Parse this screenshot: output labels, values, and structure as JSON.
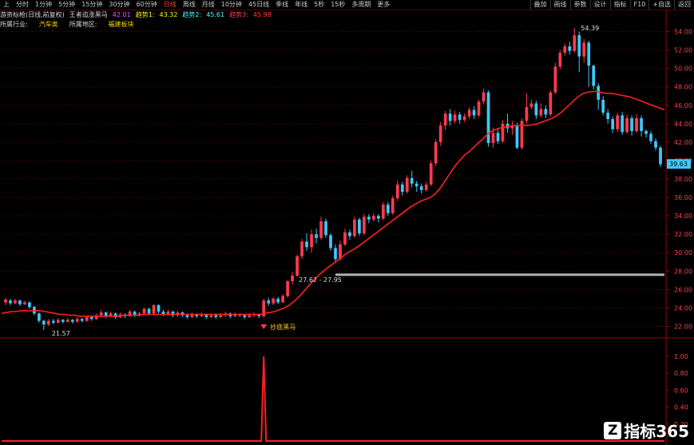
{
  "toolbar": {
    "tabs": [
      "上",
      "分时",
      "1分钟",
      "5分钟",
      "15分钟",
      "30分钟",
      "60分钟",
      "日线",
      "周线",
      "月线",
      "10分钟",
      "45日线",
      "季线",
      "年线",
      "5秒",
      "15秒",
      "多周期",
      "更多"
    ],
    "active_tab": "日线",
    "right_tabs": [
      "叠加",
      "画线",
      "参数",
      "设计",
      "指标",
      "F10",
      "+自选",
      "返回"
    ]
  },
  "indicator_row": {
    "name": "游资标枪(日线,前复权)",
    "formula": "王者追涨黑马",
    "v0_label": "42.01",
    "line1_label": "趋势1:",
    "line1_value": "43.32",
    "line2_label": "趋势2:",
    "line2_value": "45.61",
    "line3_label": "趋势3:",
    "line3_value": "45.98"
  },
  "info_row": {
    "industry_label": "所属行业:",
    "industry_value": "汽车类",
    "region_label": "所属地区:",
    "region_value": "福建板块"
  },
  "chart_data": {
    "type": "candlestick",
    "y_ticks": [
      "54.00",
      "52.00",
      "50.00",
      "48.00",
      "46.00",
      "44.00",
      "42.00",
      "40.00",
      "38.00",
      "36.00",
      "34.00",
      "32.00",
      "30.00",
      "28.00",
      "26.00",
      "24.00",
      "22.00"
    ],
    "ylim": [
      21,
      55
    ],
    "high_label": "54.39",
    "low_label": "21.57",
    "gap_label": "27.62 - 27.95",
    "current_price": "39.63",
    "signal_label": "抄底黑马",
    "support_level": 27.6,
    "colors": {
      "up": "#ff3b4e",
      "down": "#3ec8ff",
      "ma": "#ff2020",
      "signal": "#ff2020",
      "grid": "#5a0000",
      "support": "#b4b4b4"
    },
    "candles": [
      [
        24.6,
        24.9,
        24.3,
        25.1
      ],
      [
        24.8,
        24.5,
        24.3,
        25.0
      ],
      [
        24.5,
        24.8,
        24.4,
        25.0
      ],
      [
        24.8,
        24.4,
        24.2,
        24.9
      ],
      [
        24.4,
        24.6,
        24.3,
        24.8
      ],
      [
        24.6,
        24.1,
        23.9,
        24.7
      ],
      [
        24.1,
        23.4,
        23.2,
        24.2
      ],
      [
        23.4,
        22.6,
        22.4,
        23.5
      ],
      [
        22.6,
        22.2,
        21.6,
        22.7
      ],
      [
        22.2,
        22.6,
        22.0,
        22.8
      ],
      [
        22.6,
        22.4,
        22.2,
        22.8
      ],
      [
        22.4,
        22.7,
        22.3,
        22.9
      ],
      [
        22.7,
        22.5,
        22.3,
        22.8
      ],
      [
        22.5,
        22.7,
        22.4,
        22.9
      ],
      [
        22.7,
        22.5,
        22.3,
        22.8
      ],
      [
        22.5,
        22.8,
        22.4,
        23.0
      ],
      [
        22.8,
        22.6,
        22.4,
        22.9
      ],
      [
        22.6,
        23.0,
        22.5,
        23.1
      ],
      [
        23.0,
        22.8,
        22.6,
        23.1
      ],
      [
        22.8,
        23.2,
        22.7,
        23.4
      ],
      [
        23.2,
        23.5,
        23.0,
        23.8
      ],
      [
        23.5,
        23.1,
        22.9,
        23.6
      ],
      [
        23.1,
        23.4,
        23.0,
        23.6
      ],
      [
        23.4,
        23.0,
        22.8,
        23.5
      ],
      [
        23.0,
        23.3,
        22.9,
        23.5
      ],
      [
        23.3,
        23.1,
        22.9,
        23.4
      ],
      [
        23.1,
        23.6,
        23.0,
        23.8
      ],
      [
        23.6,
        23.2,
        23.0,
        23.7
      ],
      [
        23.2,
        23.4,
        23.0,
        23.6
      ],
      [
        23.4,
        23.9,
        23.3,
        24.0
      ],
      [
        23.9,
        23.4,
        23.2,
        24.0
      ],
      [
        23.4,
        24.3,
        23.3,
        24.4
      ],
      [
        24.3,
        23.6,
        23.4,
        24.4
      ],
      [
        23.6,
        23.3,
        23.1,
        23.8
      ],
      [
        23.3,
        23.6,
        23.2,
        23.8
      ],
      [
        23.6,
        23.2,
        23.0,
        23.7
      ],
      [
        23.2,
        23.5,
        23.0,
        23.7
      ],
      [
        23.5,
        23.2,
        23.0,
        23.6
      ],
      [
        23.2,
        23.0,
        22.8,
        23.4
      ],
      [
        23.0,
        23.3,
        22.9,
        23.5
      ],
      [
        23.3,
        23.1,
        22.9,
        23.4
      ],
      [
        23.1,
        23.3,
        23.0,
        23.5
      ],
      [
        23.3,
        23.0,
        22.8,
        23.4
      ],
      [
        23.0,
        23.2,
        22.9,
        23.4
      ],
      [
        23.2,
        23.0,
        22.8,
        23.4
      ],
      [
        23.0,
        23.2,
        22.9,
        23.4
      ],
      [
        23.2,
        23.4,
        23.0,
        23.6
      ],
      [
        23.4,
        23.1,
        22.9,
        23.5
      ],
      [
        23.1,
        23.3,
        23.0,
        23.5
      ],
      [
        23.3,
        23.2,
        23.0,
        23.4
      ],
      [
        23.2,
        23.0,
        22.8,
        23.3
      ],
      [
        23.0,
        23.2,
        22.9,
        23.4
      ],
      [
        23.2,
        23.3,
        23.0,
        23.5
      ],
      [
        23.3,
        23.1,
        22.9,
        23.4
      ],
      [
        23.1,
        24.8,
        23.0,
        25.0
      ],
      [
        24.8,
        24.5,
        24.2,
        25.1
      ],
      [
        24.5,
        25.0,
        24.3,
        25.2
      ],
      [
        25.0,
        24.6,
        24.4,
        25.2
      ],
      [
        24.6,
        25.3,
        24.5,
        25.5
      ],
      [
        25.3,
        26.9,
        25.1,
        27.0
      ],
      [
        26.9,
        27.5,
        26.5,
        27.9
      ],
      [
        27.5,
        29.6,
        27.4,
        29.8
      ],
      [
        29.6,
        31.2,
        29.3,
        31.5
      ],
      [
        31.2,
        30.6,
        30.2,
        32.1
      ],
      [
        30.6,
        32.0,
        30.0,
        32.5
      ],
      [
        32.0,
        31.6,
        31.0,
        32.6
      ],
      [
        31.6,
        33.4,
        31.4,
        33.9
      ],
      [
        33.4,
        31.9,
        31.6,
        33.7
      ],
      [
        31.9,
        30.5,
        30.2,
        32.1
      ],
      [
        30.5,
        29.3,
        28.9,
        30.9
      ],
      [
        29.3,
        30.9,
        29.1,
        31.3
      ],
      [
        30.9,
        32.2,
        30.7,
        32.6
      ],
      [
        32.2,
        31.8,
        31.4,
        32.5
      ],
      [
        31.8,
        33.6,
        31.6,
        33.9
      ],
      [
        33.6,
        32.1,
        31.8,
        33.8
      ],
      [
        32.1,
        33.9,
        31.9,
        34.2
      ],
      [
        33.9,
        33.6,
        33.2,
        34.2
      ],
      [
        33.6,
        34.0,
        33.4,
        34.3
      ],
      [
        34.0,
        33.7,
        33.3,
        34.2
      ],
      [
        33.7,
        35.2,
        33.5,
        35.5
      ],
      [
        35.2,
        34.3,
        34.0,
        35.5
      ],
      [
        34.3,
        35.9,
        34.1,
        36.2
      ],
      [
        35.9,
        37.4,
        35.6,
        37.8
      ],
      [
        37.4,
        36.6,
        36.2,
        37.7
      ],
      [
        36.6,
        38.1,
        36.4,
        38.4
      ],
      [
        38.1,
        37.5,
        37.1,
        38.9
      ],
      [
        37.5,
        37.2,
        36.6,
        37.8
      ],
      [
        37.2,
        36.8,
        36.4,
        37.5
      ],
      [
        36.8,
        37.4,
        36.6,
        37.7
      ],
      [
        37.4,
        39.7,
        37.2,
        40.0
      ],
      [
        39.7,
        42.0,
        39.4,
        42.3
      ],
      [
        42.0,
        43.8,
        41.6,
        44.2
      ],
      [
        43.8,
        45.1,
        43.3,
        45.4
      ],
      [
        45.1,
        44.3,
        43.8,
        45.6
      ],
      [
        44.3,
        45.0,
        44.0,
        45.4
      ],
      [
        45.0,
        44.4,
        44.0,
        45.3
      ],
      [
        44.4,
        44.8,
        44.2,
        45.1
      ],
      [
        44.8,
        45.5,
        44.5,
        45.8
      ],
      [
        45.5,
        44.9,
        44.5,
        45.9
      ],
      [
        44.9,
        46.4,
        44.7,
        46.6
      ],
      [
        46.4,
        47.4,
        46.1,
        47.8
      ],
      [
        47.4,
        41.9,
        41.5,
        47.6
      ],
      [
        41.9,
        43.0,
        41.4,
        43.6
      ],
      [
        43.0,
        42.1,
        41.8,
        43.4
      ],
      [
        42.1,
        44.0,
        41.9,
        44.4
      ],
      [
        44.0,
        43.5,
        43.0,
        45.1
      ],
      [
        43.5,
        43.8,
        42.8,
        44.3
      ],
      [
        43.8,
        41.4,
        41.2,
        44.1
      ],
      [
        41.4,
        44.3,
        41.2,
        44.6
      ],
      [
        44.3,
        45.8,
        44.0,
        47.3
      ],
      [
        45.8,
        46.2,
        45.6,
        46.6
      ],
      [
        46.2,
        44.9,
        44.5,
        46.5
      ],
      [
        44.9,
        45.6,
        44.7,
        46.2
      ],
      [
        45.6,
        45.0,
        44.6,
        46.0
      ],
      [
        45.0,
        47.4,
        44.8,
        47.6
      ],
      [
        47.4,
        50.2,
        47.2,
        50.6
      ],
      [
        50.2,
        51.7,
        49.9,
        52.0
      ],
      [
        51.7,
        52.4,
        51.4,
        52.7
      ],
      [
        52.4,
        51.9,
        51.5,
        52.9
      ],
      [
        51.9,
        53.6,
        51.7,
        54.4
      ],
      [
        53.6,
        51.3,
        49.6,
        54.0
      ],
      [
        51.3,
        52.8,
        50.6,
        53.2
      ],
      [
        52.8,
        50.3,
        48.0,
        53.0
      ],
      [
        50.3,
        48.1,
        47.7,
        50.4
      ],
      [
        48.1,
        46.6,
        45.5,
        48.4
      ],
      [
        46.6,
        45.2,
        44.9,
        47.0
      ],
      [
        45.2,
        44.5,
        44.0,
        45.6
      ],
      [
        44.5,
        43.4,
        43.0,
        44.8
      ],
      [
        43.4,
        44.9,
        43.1,
        45.2
      ],
      [
        44.9,
        43.1,
        42.8,
        45.3
      ],
      [
        43.1,
        44.6,
        42.9,
        45.0
      ],
      [
        44.6,
        43.2,
        42.7,
        44.9
      ],
      [
        43.2,
        44.6,
        43.0,
        45.0
      ],
      [
        44.6,
        43.2,
        42.6,
        44.9
      ],
      [
        43.2,
        42.9,
        42.5,
        43.4
      ],
      [
        42.9,
        42.1,
        41.8,
        43.2
      ],
      [
        42.1,
        41.4,
        41.1,
        42.4
      ],
      [
        41.4,
        39.6,
        39.3,
        41.6
      ]
    ],
    "ma_trend": [
      23.4,
      23.5,
      23.6,
      23.6,
      23.7,
      23.7,
      23.7,
      23.7,
      23.7,
      23.6,
      23.5,
      23.4,
      23.3,
      23.3,
      23.2,
      23.2,
      23.1,
      23.1,
      23.1,
      23.1,
      23.1,
      23.1,
      23.1,
      23.1,
      23.1,
      23.2,
      23.2,
      23.2,
      23.2,
      23.3,
      23.3,
      23.3,
      23.3,
      23.3,
      23.3,
      23.3,
      23.3,
      23.3,
      23.3,
      23.3,
      23.3,
      23.3,
      23.3,
      23.3,
      23.3,
      23.3,
      23.3,
      23.3,
      23.3,
      23.3,
      23.3,
      23.3,
      23.3,
      23.3,
      23.4,
      23.5,
      23.6,
      23.8,
      24.0,
      24.3,
      24.7,
      25.2,
      25.8,
      26.4,
      27.0,
      27.5,
      28.0,
      28.4,
      28.8,
      29.2,
      29.6,
      30.0,
      30.3,
      30.6,
      31.0,
      31.4,
      31.8,
      32.2,
      32.6,
      33.0,
      33.4,
      33.8,
      34.2,
      34.6,
      35.0,
      35.3,
      35.6,
      35.8,
      36.0,
      36.4,
      37.0,
      37.8,
      38.6,
      39.4,
      40.0,
      40.6,
      41.0,
      41.5,
      42.0,
      42.5,
      43.0,
      43.3,
      43.5,
      43.6,
      43.7,
      43.8,
      43.8,
      43.8,
      43.8,
      43.9,
      44.0,
      44.2,
      44.4,
      44.6,
      44.9,
      45.3,
      45.8,
      46.3,
      46.8,
      47.2,
      47.4,
      47.5,
      47.5,
      47.4,
      47.3,
      47.3,
      47.2,
      47.1,
      47.0,
      46.9,
      46.7,
      46.5,
      46.3,
      46.1,
      45.9,
      45.7,
      45.5
    ]
  }
}
